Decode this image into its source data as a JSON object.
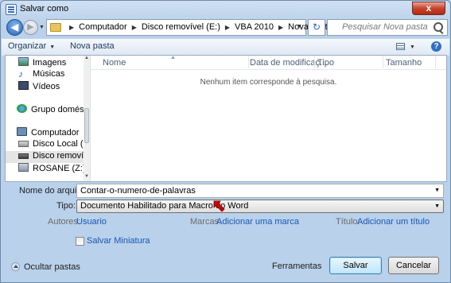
{
  "window": {
    "title": "Salvar como",
    "close": "x"
  },
  "nav": {
    "back": "◀",
    "forward": "▶",
    "breadcrumb": [
      "Computador",
      "Disco removível (E:)",
      "VBA 2010",
      "Nova pasta"
    ],
    "search_placeholder": "Pesquisar Nova pasta"
  },
  "toolbar": {
    "organize": "Organizar",
    "new_folder": "Nova pasta"
  },
  "nav_pane": {
    "items": [
      {
        "label": "Imagens",
        "icon": "images-icon"
      },
      {
        "label": "Músicas",
        "icon": "music-icon"
      },
      {
        "label": "Vídeos",
        "icon": "video-icon"
      },
      {
        "label": "Grupo doméstico",
        "icon": "homegroup-icon"
      },
      {
        "label": "Computador",
        "icon": "computer-icon"
      },
      {
        "label": "Disco Local (C:)",
        "icon": "local-disk-icon"
      },
      {
        "label": "Disco removível",
        "icon": "removable-disk-icon",
        "selected": true
      },
      {
        "label": "ROSANE (Z:)",
        "icon": "network-drive-icon"
      }
    ]
  },
  "file_list": {
    "columns": [
      "Nome",
      "Data de modificaç...",
      "Tipo",
      "Tamanho"
    ],
    "empty_message": "Nenhum item corresponde à pesquisa."
  },
  "form": {
    "filename_label": "Nome do arquivo:",
    "filename_value": "Contar-o-numero-de-palavras",
    "type_label": "Tipo:",
    "type_value": "Documento Habilitado para Macro do Word",
    "authors_label": "Autores:",
    "authors_value": "Usuario",
    "tags_label": "Marcas:",
    "tags_value": "Adicionar uma marca",
    "title_label": "Título:",
    "title_value": "Adicionar um título",
    "thumbnail_label": "Salvar Miniatura",
    "hide_folders": "Ocultar pastas",
    "tools": "Ferramentas",
    "save": "Salvar",
    "cancel": "Cancelar"
  },
  "colors": {
    "accent_link": "#1a56b4",
    "annotation_arrow": "#d40000"
  }
}
